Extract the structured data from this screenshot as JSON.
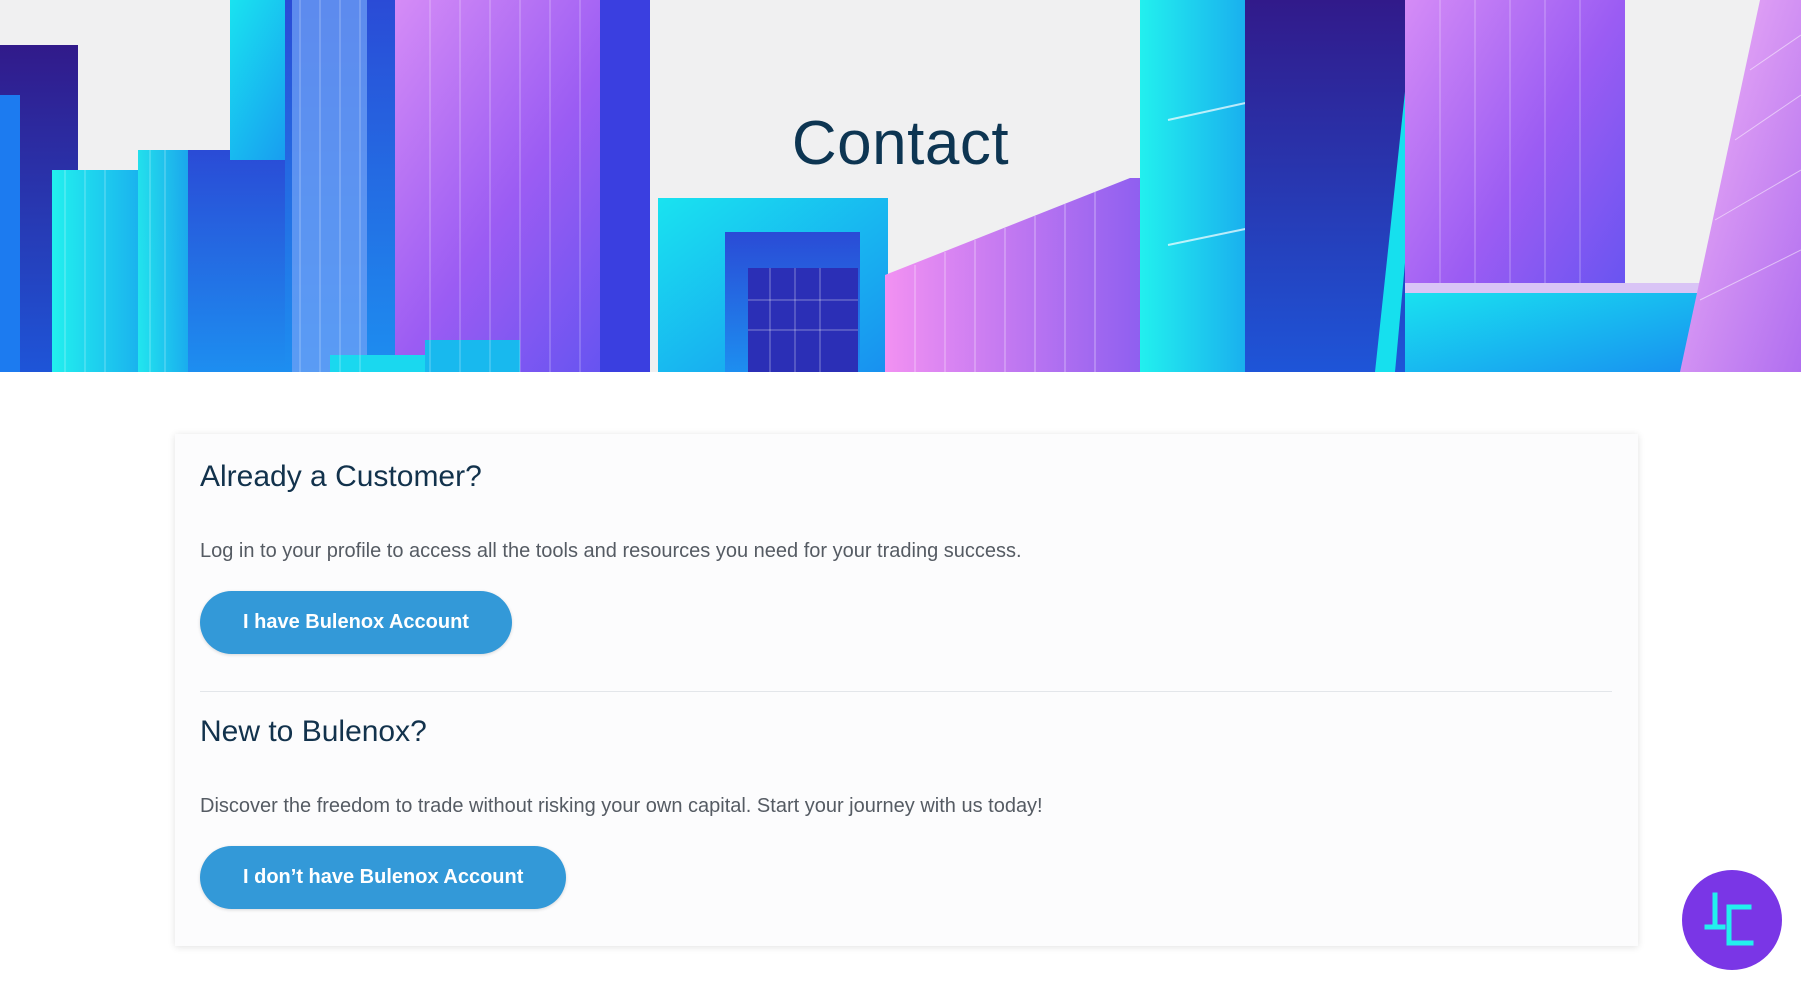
{
  "hero": {
    "title": "Contact"
  },
  "existing_customer": {
    "title": "Already a Customer?",
    "description": "Log in to your profile to access all the tools and resources you need for your trading success.",
    "button_label": "I have Bulenox Account"
  },
  "new_customer": {
    "title": "New to Bulenox?",
    "description": "Discover the freedom to trade without risking your own capital. Start your journey with us today!",
    "button_label": "I don’t have Bulenox Account"
  },
  "colors": {
    "heading": "#0d3552",
    "button": "#3399d8",
    "badge": "#7a36e6",
    "hero_background": "#f0f0f1"
  },
  "icons": {
    "badge": "tc-logo-icon"
  }
}
